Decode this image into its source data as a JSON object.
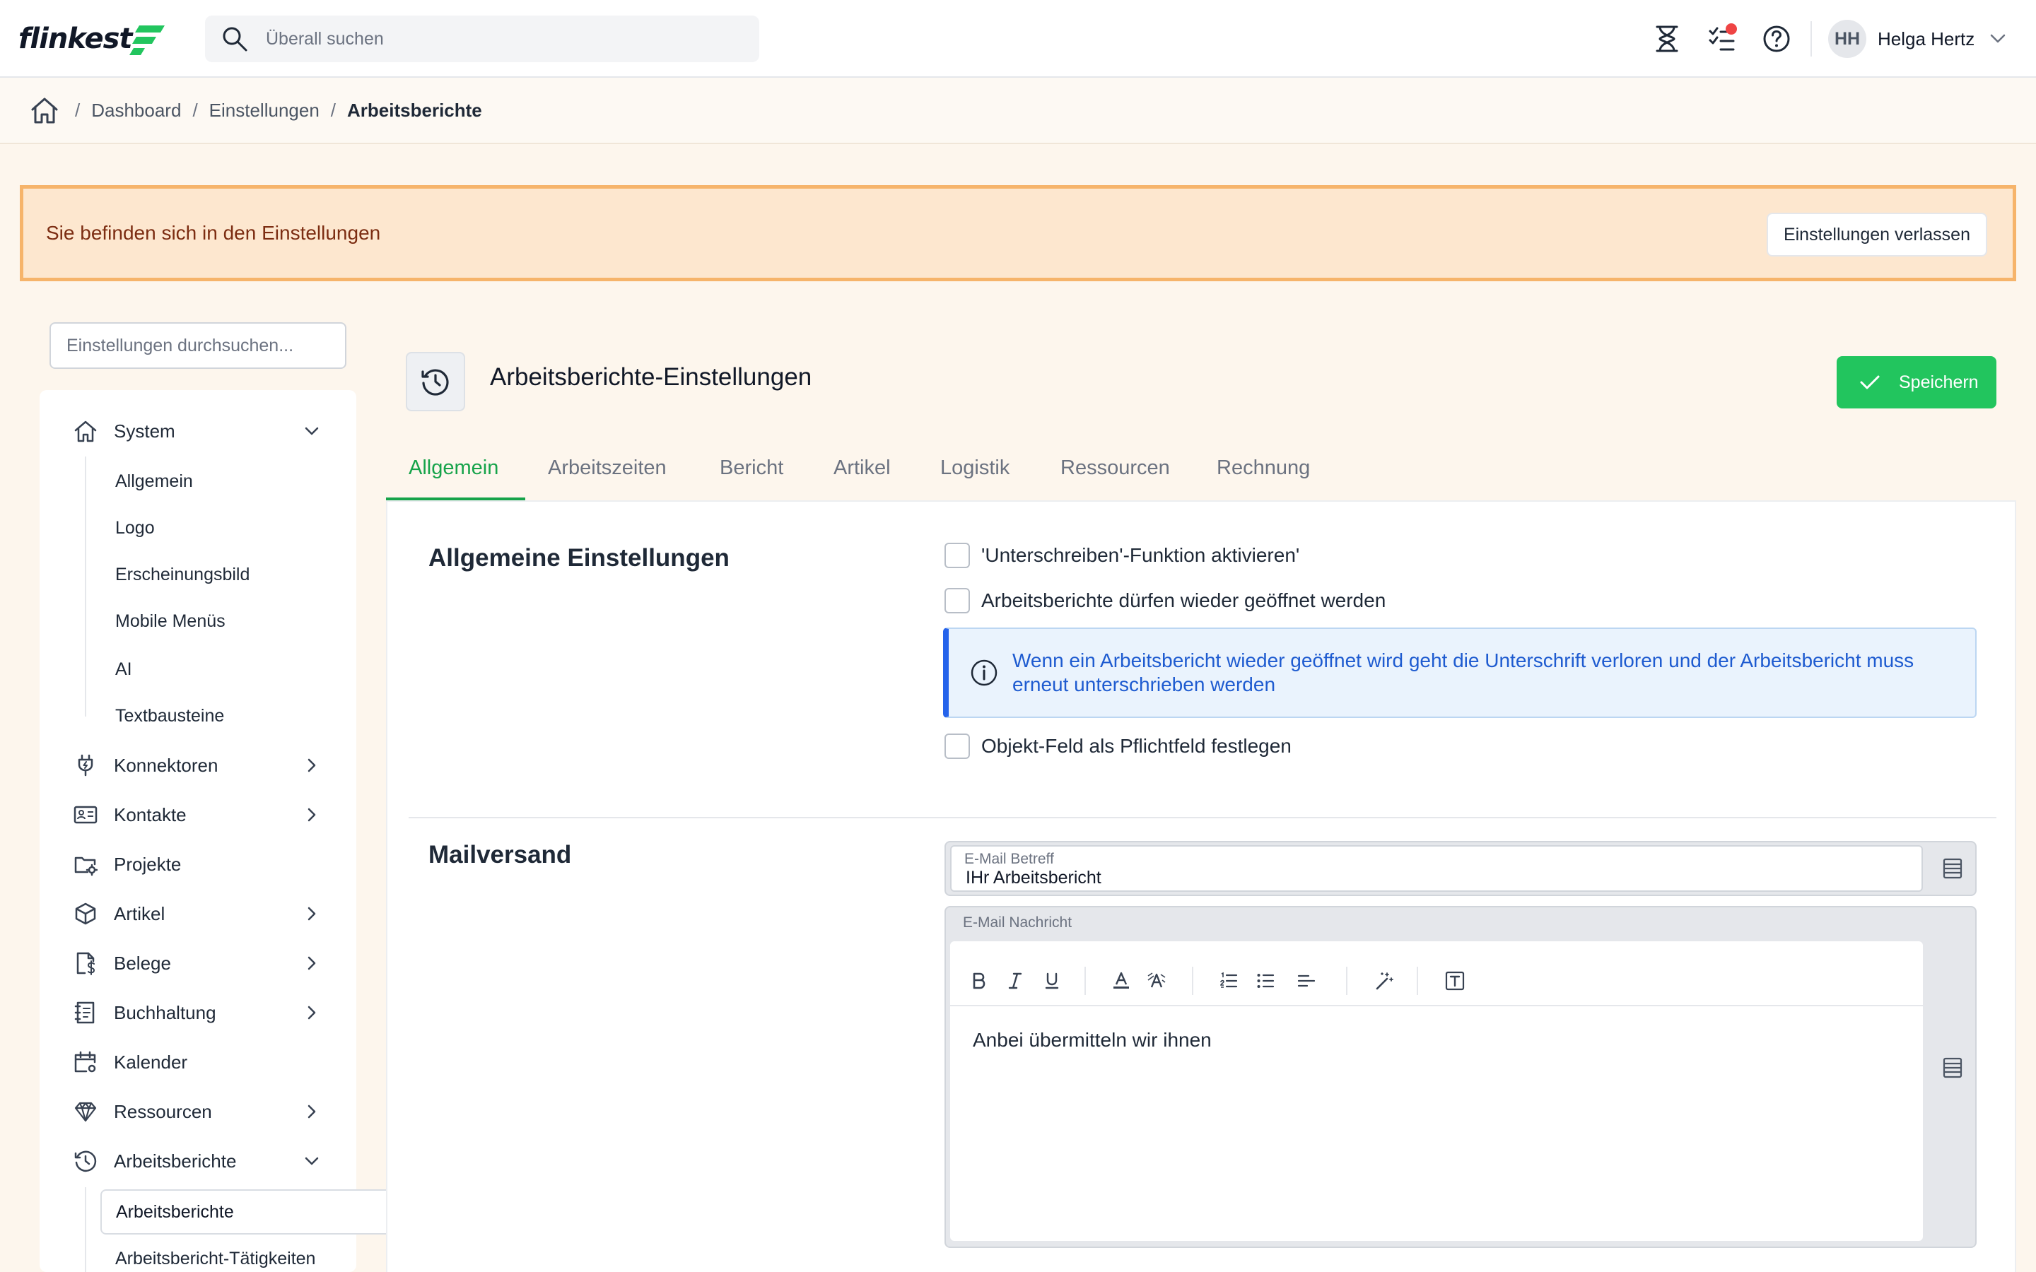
{
  "header": {
    "logo_text": "flinkest",
    "search_placeholder": "Überall suchen",
    "user": {
      "initials": "HH",
      "name": "Helga Hertz"
    }
  },
  "breadcrumb": {
    "items": [
      "Dashboard",
      "Einstellungen"
    ],
    "current": "Arbeitsberichte"
  },
  "banner": {
    "text": "Sie befinden sich in den Einstellungen",
    "button_label": "Einstellungen verlassen"
  },
  "sidebar": {
    "search_placeholder": "Einstellungen durchsuchen...",
    "system": {
      "label": "System",
      "children": [
        "Allgemein",
        "Logo",
        "Erscheinungsbild",
        "Mobile Menüs",
        "AI",
        "Textbausteine"
      ]
    },
    "items": [
      "Konnektoren",
      "Kontakte",
      "Projekte",
      "Artikel",
      "Belege",
      "Buchhaltung",
      "Kalender",
      "Ressourcen"
    ],
    "arbeitsberichte": {
      "label": "Arbeitsberichte",
      "children": [
        "Arbeitsberichte",
        "Arbeitsbericht-Tätigkeiten"
      ],
      "active_child": "Arbeitsberichte"
    }
  },
  "page": {
    "title": "Arbeitsberichte-Einstellungen",
    "save_label": "Speichern"
  },
  "tabs": [
    "Allgemein",
    "Arbeitszeiten",
    "Bericht",
    "Artikel",
    "Logistik",
    "Ressourcen",
    "Rechnung"
  ],
  "active_tab": "Allgemein",
  "general": {
    "title": "Allgemeine Einstellungen",
    "checkbox_sign": "'Unterschreiben'-Funktion aktivieren'",
    "checkbox_reopen": "Arbeitsberichte dürfen wieder geöffnet werden",
    "info": "Wenn ein Arbeitsbericht wieder geöffnet wird geht die Unterschrift verloren und der Arbeitsbericht muss erneut unterschrieben werden",
    "checkbox_object": "Objekt-Feld als Pflichtfeld festlegen"
  },
  "mail": {
    "title": "Mailversand",
    "subject_label": "E-Mail Betreff",
    "subject_value": "IHr Arbeitsbericht",
    "message_label": "E-Mail Nachricht",
    "message_body": "Anbei übermitteln wir ihnen"
  },
  "colors": {
    "brand": "#22c55e",
    "banner_bg": "#fde7cf",
    "banner_border": "#f6b46b",
    "info_accent": "#2563eb"
  }
}
